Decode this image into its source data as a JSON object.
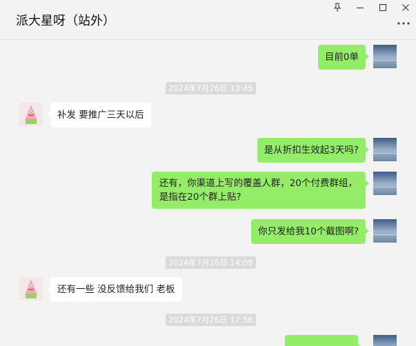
{
  "window": {
    "title": "派大星呀（站外）",
    "controls": {
      "pin_icon": "pin-icon",
      "minimize_icon": "minimize-icon",
      "maximize_icon": "maximize-icon",
      "close_icon": "close-icon",
      "more_icon": "more-icon"
    }
  },
  "colors": {
    "outgoing_bubble": "#95ec69",
    "incoming_bubble": "#ffffff",
    "chat_background": "#f3f3f3",
    "timestamp_background": "#dadada"
  },
  "messages": [
    {
      "type": "out",
      "text": "目前0单"
    },
    {
      "type": "time",
      "text": "2024年7月26日 13:45"
    },
    {
      "type": "in",
      "text": "补发 要推广三天以后"
    },
    {
      "type": "out",
      "text": "是从折扣生效起3天吗?"
    },
    {
      "type": "out",
      "lines": [
        "还有，你渠道上写的覆盖人群，20个付费群组，",
        "是指在20个群上贴?"
      ]
    },
    {
      "type": "out",
      "text": "你只发给我10个截图啊?"
    },
    {
      "type": "time",
      "text": "2024年7月26日 14:09"
    },
    {
      "type": "in",
      "text": "还有一些 没反馈给我们 老板"
    },
    {
      "type": "time",
      "text": "2024年7月26日 17:56"
    },
    {
      "type": "out",
      "text": ""
    }
  ]
}
